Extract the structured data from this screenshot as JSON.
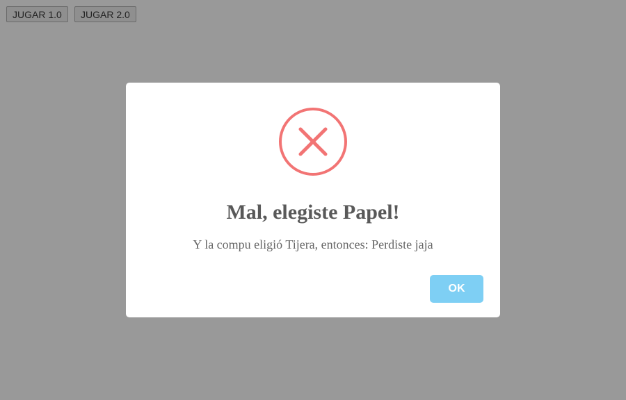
{
  "toolbar": {
    "play1": "JUGAR 1.0",
    "play2": "JUGAR 2.0"
  },
  "dialog": {
    "icon": "error-x-icon",
    "title": "Mal, elegiste Papel!",
    "text": "Y la compu eligió Tijera, entonces: Perdiste jaja",
    "ok": "OK",
    "error_color": "#f27474",
    "button_color": "#7ecff4"
  }
}
